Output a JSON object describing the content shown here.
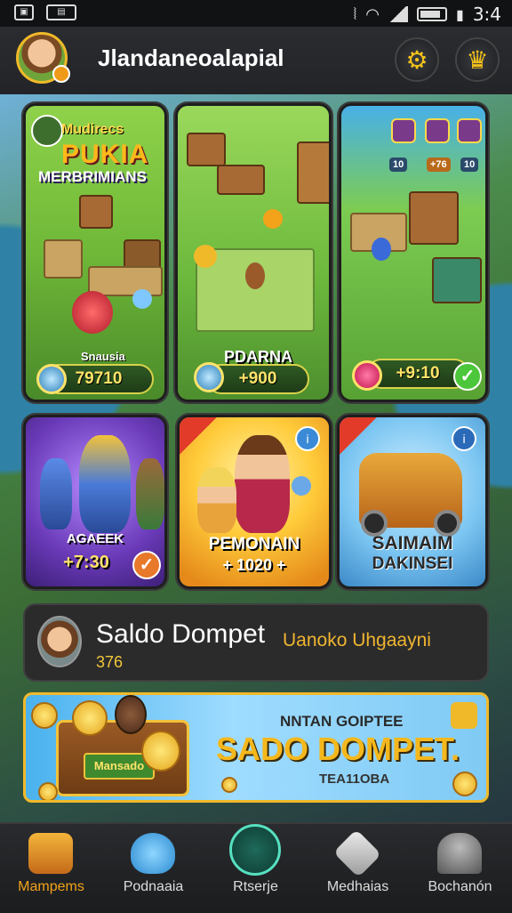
{
  "status_bar": {
    "time": "3:4",
    "left_icons": [
      "gallery-icon",
      "photo-icon"
    ],
    "right_icons": [
      "vibrate-icon",
      "wifi-icon",
      "signal-icon",
      "battery-icon"
    ]
  },
  "header": {
    "player_name": "Jlandaneoalapial"
  },
  "cards_top": [
    {
      "title_small": "Mudirecs",
      "title_big": "PUKIA",
      "subtitle": "MERBRIMIANS",
      "caption": "Snausia",
      "value": "79710"
    },
    {
      "caption": "PDARNA",
      "value": "+900"
    },
    {
      "value": "+9:10",
      "stats": [
        "10",
        "+76",
        "10"
      ]
    }
  ],
  "cards_bottom": [
    {
      "title": "AGAEEK",
      "value": "+7:30"
    },
    {
      "title": "PEMONAIN",
      "value": "+ 1020 +"
    },
    {
      "title": "SAIMAIM",
      "subtitle": "DAKINSEI"
    }
  ],
  "wallet": {
    "title": "Saldo Dompet",
    "value": "376",
    "side_text": "Uanoko Uhgaayni"
  },
  "banner": {
    "chest_label": "Mansado",
    "subtitle": "NNTAN GOIPTEE",
    "headline": "SADO DOMPET.",
    "subtitle2": "TEA11OBA"
  },
  "nav": [
    {
      "label": "Mampems",
      "icon": "shop-icon",
      "active": true
    },
    {
      "label": "Podnaaia",
      "icon": "pet-icon",
      "active": false
    },
    {
      "label": "Rtserje",
      "icon": "battle-icon",
      "active": false
    },
    {
      "label": "Medhaias",
      "icon": "dice-icon",
      "active": false
    },
    {
      "label": "Bochanón",
      "icon": "profile-icon",
      "active": false
    }
  ],
  "colors": {
    "accent": "#f0b92a",
    "active_nav": "#f2a31a",
    "coin_text": "#ffe36a"
  }
}
